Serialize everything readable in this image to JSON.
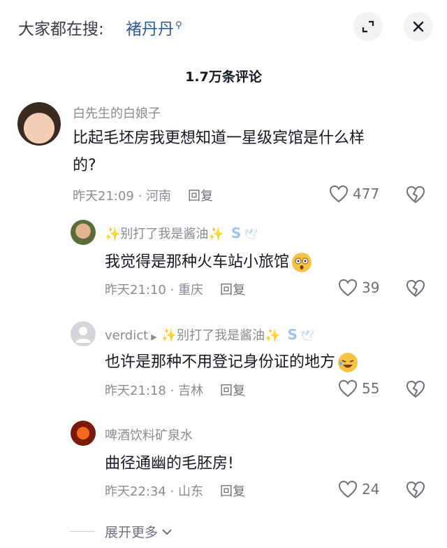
{
  "header": {
    "search_prefix": "大家都在搜:",
    "search_term": "褚丹丹",
    "search_icon": "magnifier-icon",
    "collapse_icon": "collapse-icon",
    "close_icon": "close-icon"
  },
  "comments_count": "1.7万条评论",
  "comments": [
    {
      "user": "白先生的白娘子",
      "text_line1": "比起毛坯房我更想知道一星级宾馆是什么样",
      "text_line2": "的?",
      "time": "昨天21:09",
      "location": "河南",
      "reply_label": "回复",
      "likes": "477"
    },
    {
      "user": "✨别打了我是酱油✨",
      "text": "我觉得是那种火车站小旅馆",
      "time": "昨天21:10",
      "location": "重庆",
      "reply_label": "回复",
      "likes": "39"
    },
    {
      "user": "verdict",
      "reply_to": "✨别打了我是酱油✨",
      "text": "也许是那种不用登记身份证的地方",
      "time": "昨天21:18",
      "location": "吉林",
      "reply_label": "回复",
      "likes": "55"
    },
    {
      "user": "啤酒饮料矿泉水",
      "text": "曲径通幽的毛胚房!",
      "time": "昨天22:34",
      "location": "山东",
      "reply_label": "回复",
      "likes": "24"
    }
  ],
  "expand_label": "展开更多",
  "colors": {
    "accent_link": "#2e5b94",
    "muted": "#8a8b91",
    "text": "#161823"
  }
}
